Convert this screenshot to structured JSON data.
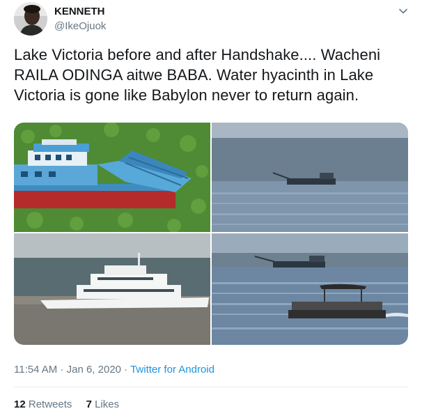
{
  "author": {
    "name": "KENNETH",
    "handle": "@IkeOjuok"
  },
  "tweet": {
    "text": "Lake Victoria before and after Handshake.... Wacheni RAILA ODINGA aitwe BABA.  Water hyacinth in Lake Victoria is gone like Babylon never to return again."
  },
  "photos": [
    {
      "name": "hyacinth-boat-photo"
    },
    {
      "name": "cargo-ship-distant-photo"
    },
    {
      "name": "white-ferry-photo"
    },
    {
      "name": "pontoon-boat-photo"
    }
  ],
  "meta": {
    "time": "11:54 AM",
    "separator1": " · ",
    "date": "Jan 6, 2020",
    "separator2": " · ",
    "source": "Twitter for Android"
  },
  "stats": {
    "retweets_count": "12",
    "retweets_label": "Retweets",
    "likes_count": "7",
    "likes_label": "Likes"
  },
  "colors": {
    "secondary_text": "#657786",
    "link": "#1b95e0",
    "divider": "#e6ecf0"
  },
  "icons": {
    "menu": "chevron-down-icon"
  }
}
